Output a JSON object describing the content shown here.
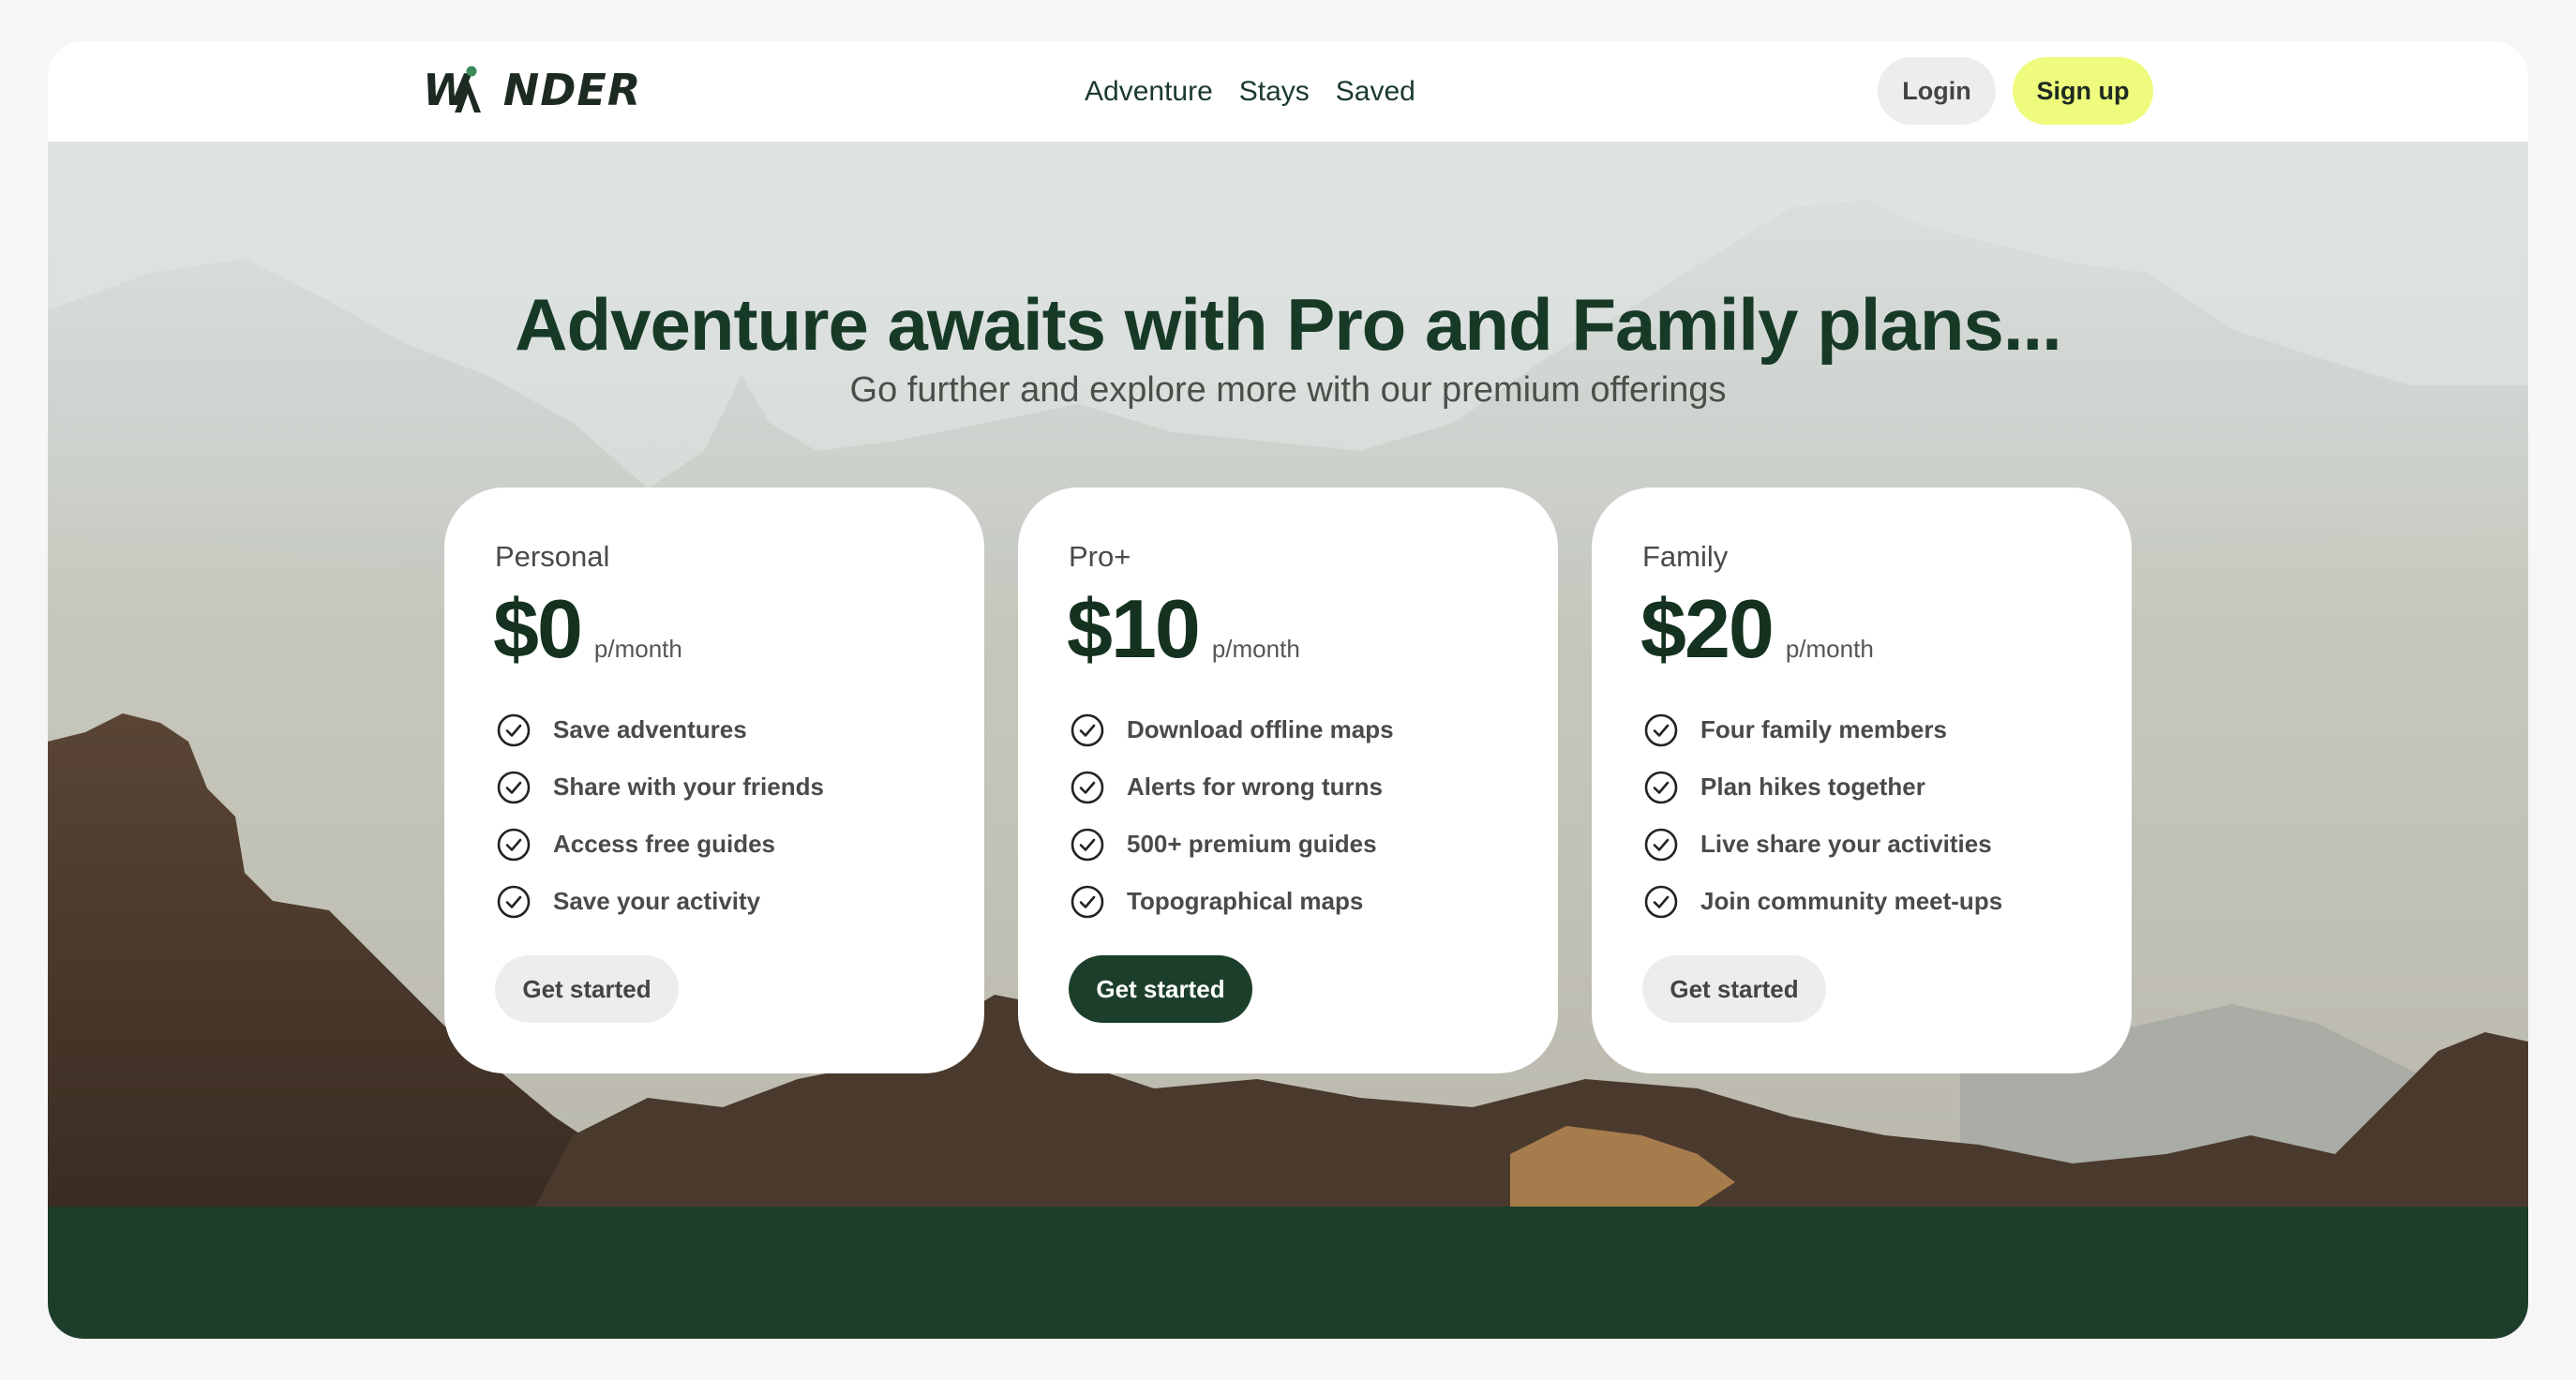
{
  "brand": {
    "logo_text": "WANDER",
    "accent": "#3a8a5a"
  },
  "nav": {
    "items": [
      "Adventure",
      "Stays",
      "Saved"
    ],
    "login_label": "Login",
    "signup_label": "Sign up"
  },
  "hero": {
    "headline": "Adventure awaits with Pro and Family plans...",
    "subheadline": "Go further and explore more with our premium offerings"
  },
  "plans": [
    {
      "name": "Personal",
      "price": "$0",
      "period": "p/month",
      "features": [
        "Save adventures",
        "Share with your friends",
        "Access free guides",
        "Save your activity"
      ],
      "cta_label": "Get started"
    },
    {
      "name": "Pro+",
      "price": "$10",
      "period": "p/month",
      "features": [
        "Download offline maps",
        "Alerts for wrong turns",
        "500+ premium guides",
        "Topographical maps"
      ],
      "cta_label": "Get started"
    },
    {
      "name": "Family",
      "price": "$20",
      "period": "p/month",
      "features": [
        "Four family members",
        "Plan hikes together",
        "Live share your activities",
        "Join community meet-ups"
      ],
      "cta_label": "Get started"
    }
  ],
  "colors": {
    "primary_dark": "#1c3f2b",
    "signup_bg": "#eefb7c",
    "button_light": "#ededed"
  },
  "icons": {
    "feature_icon": "check-circle-icon"
  }
}
